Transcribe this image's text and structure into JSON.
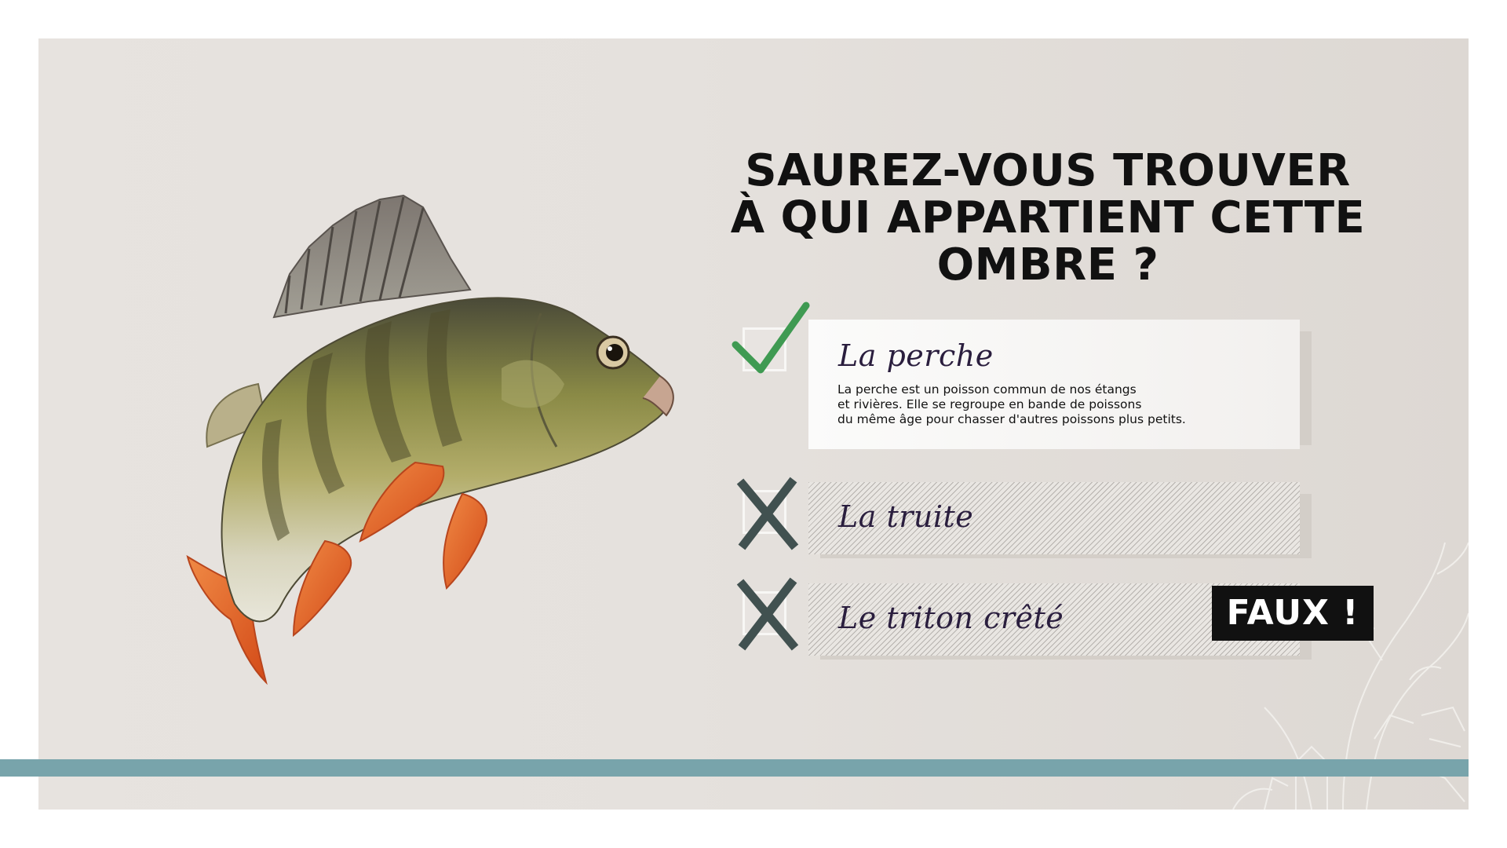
{
  "title": {
    "line1": "SAUREZ-VOUS TROUVER",
    "line2": "À QUI APPARTIENT CETTE OMBRE ?"
  },
  "answers": [
    {
      "label": "La perche",
      "state": "correct",
      "mark_icon": "checkmark-icon",
      "description": "La perche est un poisson commun de nos étangs\net rivières. Elle se regroupe en bande de poissons\ndu même âge pour chasser d'autres poissons plus petits."
    },
    {
      "label": "La truite",
      "state": "wrong",
      "mark_icon": "cross-icon"
    },
    {
      "label": "Le triton crêté",
      "state": "wrong",
      "mark_icon": "cross-icon"
    }
  ],
  "feedback": "FAUX !",
  "colors": {
    "background": "#e5e1dd",
    "accent_line": "#78a4ab",
    "check_green": "#3f9a52",
    "cross_dark": "#415150",
    "label_text": "#2a1e3e",
    "badge": "#111111"
  },
  "image": {
    "subject_icon": "perch-fish-illustration"
  }
}
